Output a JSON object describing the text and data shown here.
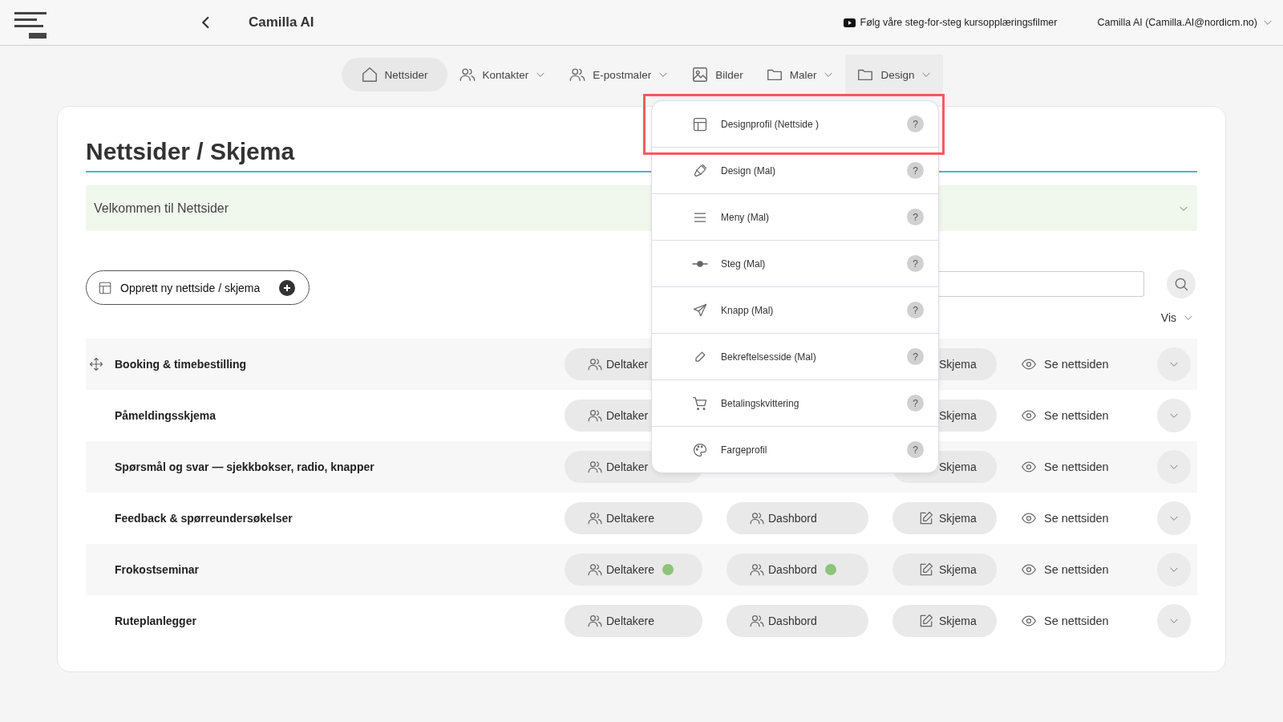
{
  "header": {
    "title": "Camilla AI",
    "tutorial_link": "Følg våre steg-for-steg kursopplæringsfilmer",
    "user": "Camilla AI (Camilla.AI@nordicm.no)"
  },
  "nav": {
    "items": [
      {
        "label": "Nettsider",
        "selected": true,
        "expanded": false,
        "has_menu": false
      },
      {
        "label": "Kontakter",
        "selected": false,
        "expanded": false,
        "has_menu": true
      },
      {
        "label": "E-postmaler",
        "selected": false,
        "expanded": false,
        "has_menu": true
      },
      {
        "label": "Bilder",
        "selected": false,
        "expanded": false,
        "has_menu": false
      },
      {
        "label": "Maler",
        "selected": false,
        "expanded": false,
        "has_menu": true
      },
      {
        "label": "Design",
        "selected": false,
        "expanded": true,
        "has_menu": true
      }
    ]
  },
  "design_menu": {
    "items": [
      {
        "label": "Designprofil (Nettside )",
        "help": "?",
        "highlighted": true
      },
      {
        "label": "Design (Mal)",
        "help": "?",
        "highlighted": false
      },
      {
        "label": "Meny (Mal)",
        "help": "?",
        "highlighted": false
      },
      {
        "label": "Steg (Mal)",
        "help": "?",
        "highlighted": false
      },
      {
        "label": "Knapp (Mal)",
        "help": "?",
        "highlighted": false
      },
      {
        "label": "Bekreftelsesside (Mal)",
        "help": "?",
        "highlighted": false
      },
      {
        "label": "Betalingskvittering",
        "help": "?",
        "highlighted": false
      },
      {
        "label": "Fargeprofil",
        "help": "?",
        "highlighted": false
      }
    ]
  },
  "page": {
    "title": "Nettsider / Skjema",
    "welcome": "Velkommen til Nettsider",
    "create_button": "Opprett ny nettside / skjema",
    "view_menu": "Vis"
  },
  "rows": [
    {
      "title": "Booking & timebestilling",
      "drag_handle": true,
      "deltakere": "Deltaker",
      "deltakere_dot": false,
      "skjema": "Skjema",
      "view": "Se nettsiden"
    },
    {
      "title": "Påmeldingsskjema",
      "drag_handle": false,
      "deltakere": "Deltaker",
      "deltakere_dot": false,
      "skjema": "Skjema",
      "view": "Se nettsiden"
    },
    {
      "title": "Spørsmål og svar — sjekkbokser, radio, knapper",
      "drag_handle": false,
      "deltakere": "Deltaker",
      "deltakere_dot": false,
      "skjema": "Skjema",
      "view": "Se nettsiden"
    },
    {
      "title": "Feedback & spørreundersøkelser",
      "drag_handle": false,
      "deltakere": "Deltakere",
      "deltakere_dot": false,
      "dashbord": "Dashbord",
      "dashbord_dot": false,
      "skjema": "Skjema",
      "view": "Se nettsiden"
    },
    {
      "title": "Frokostseminar",
      "drag_handle": false,
      "deltakere": "Deltakere",
      "deltakere_dot": true,
      "dashbord": "Dashbord",
      "dashbord_dot": true,
      "skjema": "Skjema",
      "view": "Se nettsiden"
    },
    {
      "title": "Ruteplanlegger",
      "drag_handle": false,
      "deltakere": "Deltakere",
      "deltakere_dot": false,
      "dashbord": "Dashbord",
      "dashbord_dot": false,
      "skjema": "Skjema",
      "view": "Se nettsiden"
    }
  ]
}
